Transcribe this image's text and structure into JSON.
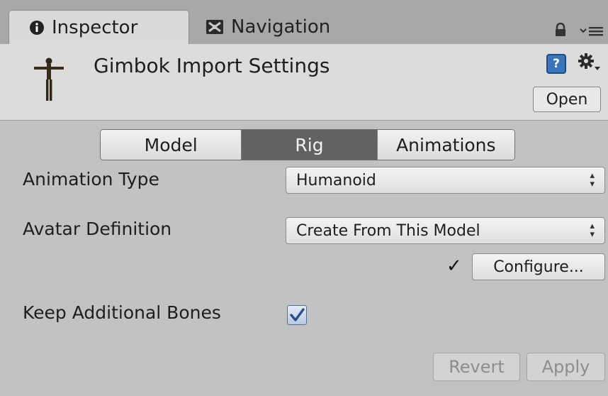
{
  "tabs": {
    "inspector": "Inspector",
    "navigation": "Navigation"
  },
  "header": {
    "title": "Gimbok Import Settings",
    "open_label": "Open",
    "help_glyph": "?"
  },
  "segments": [
    "Model",
    "Rig",
    "Animations"
  ],
  "selected_segment": "Rig",
  "fields": {
    "animation_type": {
      "label": "Animation Type",
      "value": "Humanoid"
    },
    "avatar_definition": {
      "label": "Avatar Definition",
      "value": "Create From This Model"
    },
    "configure_label": "Configure...",
    "keep_bones": {
      "label": "Keep Additional Bones",
      "checked": true
    }
  },
  "buttons": {
    "revert": "Revert",
    "apply": "Apply"
  },
  "icons": {
    "inspector": "info-icon",
    "navigation": "navigation-icon",
    "lock": "lock-icon",
    "menu": "menu-icon",
    "help": "help-icon",
    "gear": "gear-icon"
  },
  "colors": {
    "selected_segment_bg": "#626262",
    "checkbox_tick": "#2c4d86"
  }
}
